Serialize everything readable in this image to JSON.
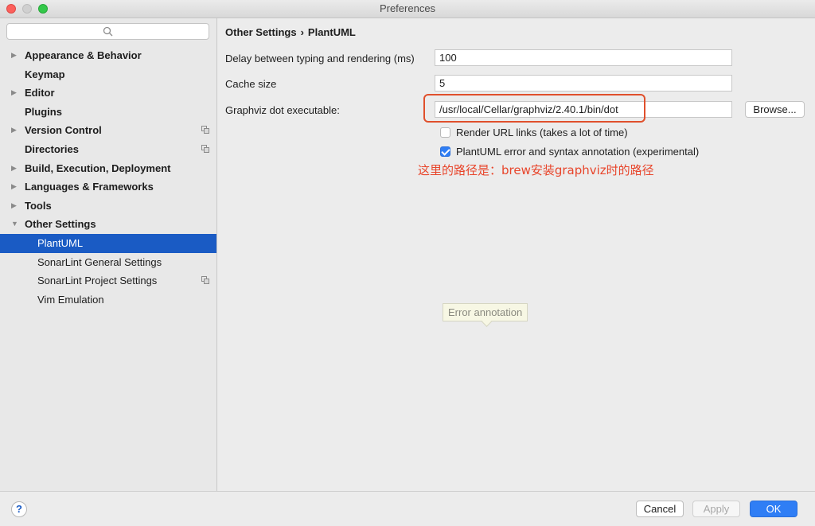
{
  "window": {
    "title": "Preferences"
  },
  "sidebar": {
    "search": {
      "placeholder": ""
    },
    "items": [
      {
        "label": "Appearance & Behavior",
        "expandable": true,
        "expanded": false,
        "level": 0,
        "project_icon": false
      },
      {
        "label": "Keymap",
        "expandable": false,
        "level": 0,
        "project_icon": false
      },
      {
        "label": "Editor",
        "expandable": true,
        "expanded": false,
        "level": 0,
        "project_icon": false
      },
      {
        "label": "Plugins",
        "expandable": false,
        "level": 0,
        "project_icon": false
      },
      {
        "label": "Version Control",
        "expandable": true,
        "expanded": false,
        "level": 0,
        "project_icon": true
      },
      {
        "label": "Directories",
        "expandable": false,
        "level": 0,
        "project_icon": true
      },
      {
        "label": "Build, Execution, Deployment",
        "expandable": true,
        "expanded": false,
        "level": 0,
        "project_icon": false
      },
      {
        "label": "Languages & Frameworks",
        "expandable": true,
        "expanded": false,
        "level": 0,
        "project_icon": false
      },
      {
        "label": "Tools",
        "expandable": true,
        "expanded": false,
        "level": 0,
        "project_icon": false
      },
      {
        "label": "Other Settings",
        "expandable": true,
        "expanded": true,
        "level": 0,
        "project_icon": false
      },
      {
        "label": "PlantUML",
        "expandable": false,
        "level": 1,
        "selected": true,
        "project_icon": false
      },
      {
        "label": "SonarLint General Settings",
        "expandable": false,
        "level": 1,
        "project_icon": false
      },
      {
        "label": "SonarLint Project Settings",
        "expandable": false,
        "level": 1,
        "project_icon": true
      },
      {
        "label": "Vim Emulation",
        "expandable": false,
        "level": 1,
        "project_icon": false
      }
    ]
  },
  "main": {
    "breadcrumb": {
      "parent": "Other Settings",
      "separator": "›",
      "current": "PlantUML"
    },
    "delay": {
      "label": "Delay between typing and rendering (ms)",
      "value": "100"
    },
    "cache": {
      "label": "Cache size",
      "value": "5"
    },
    "graphviz": {
      "label": "Graphviz dot executable:",
      "value": "/usr/local/Cellar/graphviz/2.40.1/bin/dot",
      "browse_label": "Browse..."
    },
    "render_url": {
      "label": "Render URL links (takes a lot of time)",
      "checked": false
    },
    "error_annotation": {
      "label": "PlantUML error and syntax annotation (experimental)",
      "checked": true
    },
    "annotation_note": "这里的路径是：brew安装graphviz时的路径",
    "tooltip": "Error annotation"
  },
  "footer": {
    "help_label": "?",
    "cancel_label": "Cancel",
    "apply_label": "Apply",
    "ok_label": "OK"
  },
  "colors": {
    "accent": "#2f7ef5",
    "selection": "#1a5bc4",
    "annotation": "#e8452b"
  }
}
